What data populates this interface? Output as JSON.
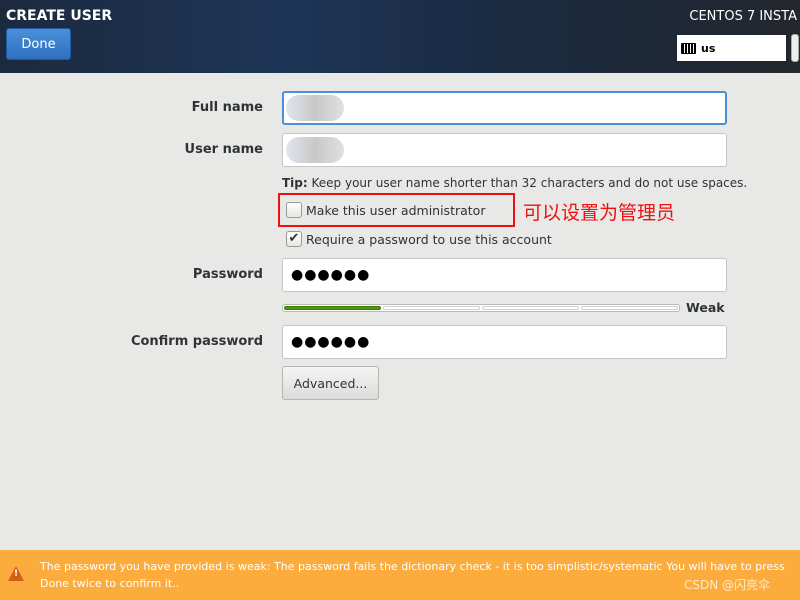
{
  "header": {
    "title": "CREATE USER",
    "done_label": "Done",
    "product": "CENTOS 7 INSTA",
    "keyboard_layout": "us"
  },
  "form": {
    "full_name": {
      "label": "Full name",
      "value": ""
    },
    "user_name": {
      "label": "User name",
      "value": ""
    },
    "tip_bold": "Tip:",
    "tip_text": " Keep your user name shorter than 32 characters and do not use spaces.",
    "admin_checkbox": {
      "label": "Make this user administrator",
      "checked": false
    },
    "require_password_checkbox": {
      "label": "Require a password to use this account",
      "checked": true
    },
    "password": {
      "label": "Password",
      "value": "●●●●●●"
    },
    "strength": {
      "level_fraction": 0.25,
      "label": "Weak",
      "color": "#4e9a06"
    },
    "confirm_password": {
      "label": "Confirm password",
      "value": "●●●●●●"
    },
    "advanced_label": "Advanced..."
  },
  "annotation": {
    "text": "可以设置为管理员",
    "color": "#f01010"
  },
  "warning": {
    "line1": "The password you have provided is weak: The password fails the dictionary check - it is too simplistic/systematic You will have to press",
    "line2": "Done twice to confirm it..",
    "color": "#fcac3d",
    "icon": "warning-icon"
  },
  "watermark": "CSDN @闪亮伞"
}
